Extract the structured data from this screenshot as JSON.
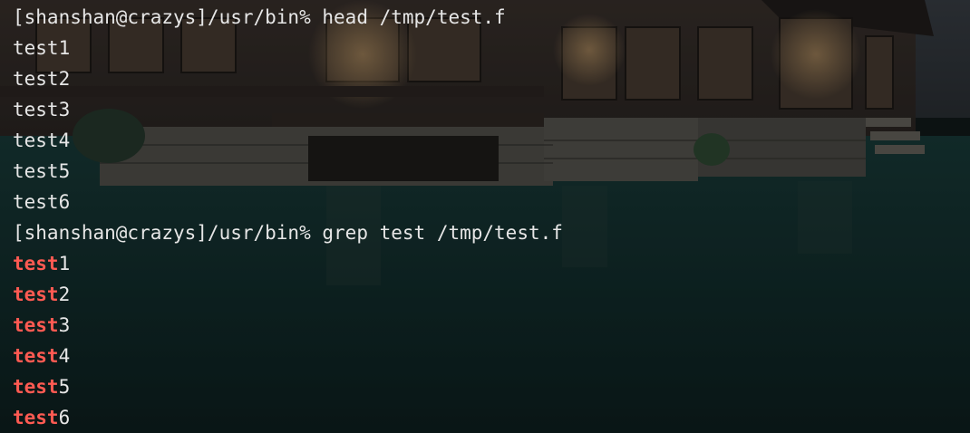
{
  "terminal": {
    "prompt": "[shanshan@crazys]/usr/bin%",
    "commands": [
      {
        "command": "head /tmp/test.f",
        "output": [
          "test1",
          "test2",
          "test3",
          "test4",
          "test5",
          "test6"
        ]
      },
      {
        "command": "grep test /tmp/test.f",
        "output": [
          {
            "match": "test",
            "rest": "1"
          },
          {
            "match": "test",
            "rest": "2"
          },
          {
            "match": "test",
            "rest": "3"
          },
          {
            "match": "test",
            "rest": "4"
          },
          {
            "match": "test",
            "rest": "5"
          },
          {
            "match": "test",
            "rest": "6"
          }
        ]
      }
    ]
  },
  "colors": {
    "text": "#e6e6e6",
    "match": "#ff5a52",
    "water": "#123130"
  }
}
